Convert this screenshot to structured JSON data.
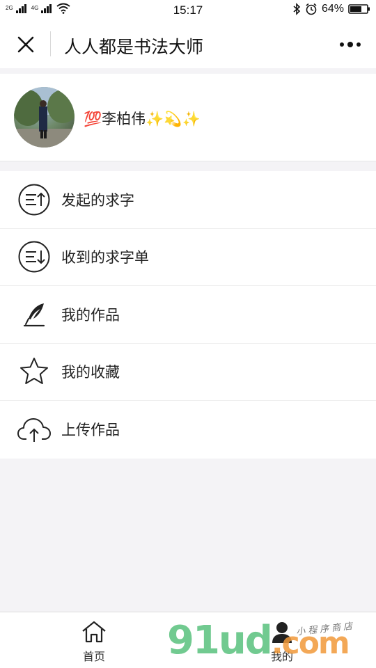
{
  "status_bar": {
    "network_top": "2G",
    "network_bottom": "4G",
    "time": "15:17",
    "battery": "64%"
  },
  "nav": {
    "title": "人人都是书法大师",
    "close_icon": "close-icon",
    "more_icon": "more-dots-icon"
  },
  "profile": {
    "username": "💯李柏伟✨💫✨"
  },
  "menu": {
    "items": [
      {
        "label": "发起的求字",
        "icon": "list-upload-icon"
      },
      {
        "label": "收到的求字单",
        "icon": "list-download-icon"
      },
      {
        "label": "我的作品",
        "icon": "quill-pen-icon"
      },
      {
        "label": "我的收藏",
        "icon": "star-icon"
      },
      {
        "label": "上传作品",
        "icon": "cloud-upload-icon"
      }
    ]
  },
  "tabbar": {
    "tabs": [
      {
        "label": "首页",
        "icon": "home-icon"
      },
      {
        "label": "我的",
        "icon": "user-icon"
      }
    ]
  },
  "watermark": {
    "text": "91ud",
    "suffix": ".com",
    "subtext": "小程序商店"
  }
}
